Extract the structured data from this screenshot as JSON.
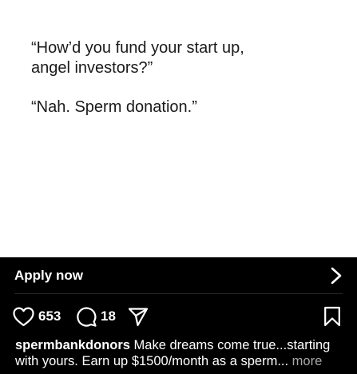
{
  "post": {
    "quote_1": "“How’d you fund your start up,\nangel investors?”",
    "quote_2": "“Nah. Sperm donation.”"
  },
  "cta": {
    "label": "Apply now",
    "icon": "chevron-right-icon"
  },
  "actions": {
    "likes": "653",
    "comments": "18",
    "icons": [
      "heart-icon",
      "comment-icon",
      "share-icon",
      "bookmark-icon"
    ]
  },
  "caption": {
    "username": "spermbankdonors",
    "text": " Make dreams come true...starting with yours. Earn up $1500/month as a sperm...",
    "more": " more"
  },
  "colors": {
    "background": "#000000",
    "post_background": "#ffffff",
    "text": "#ffffff",
    "muted": "#a8a8a8"
  }
}
